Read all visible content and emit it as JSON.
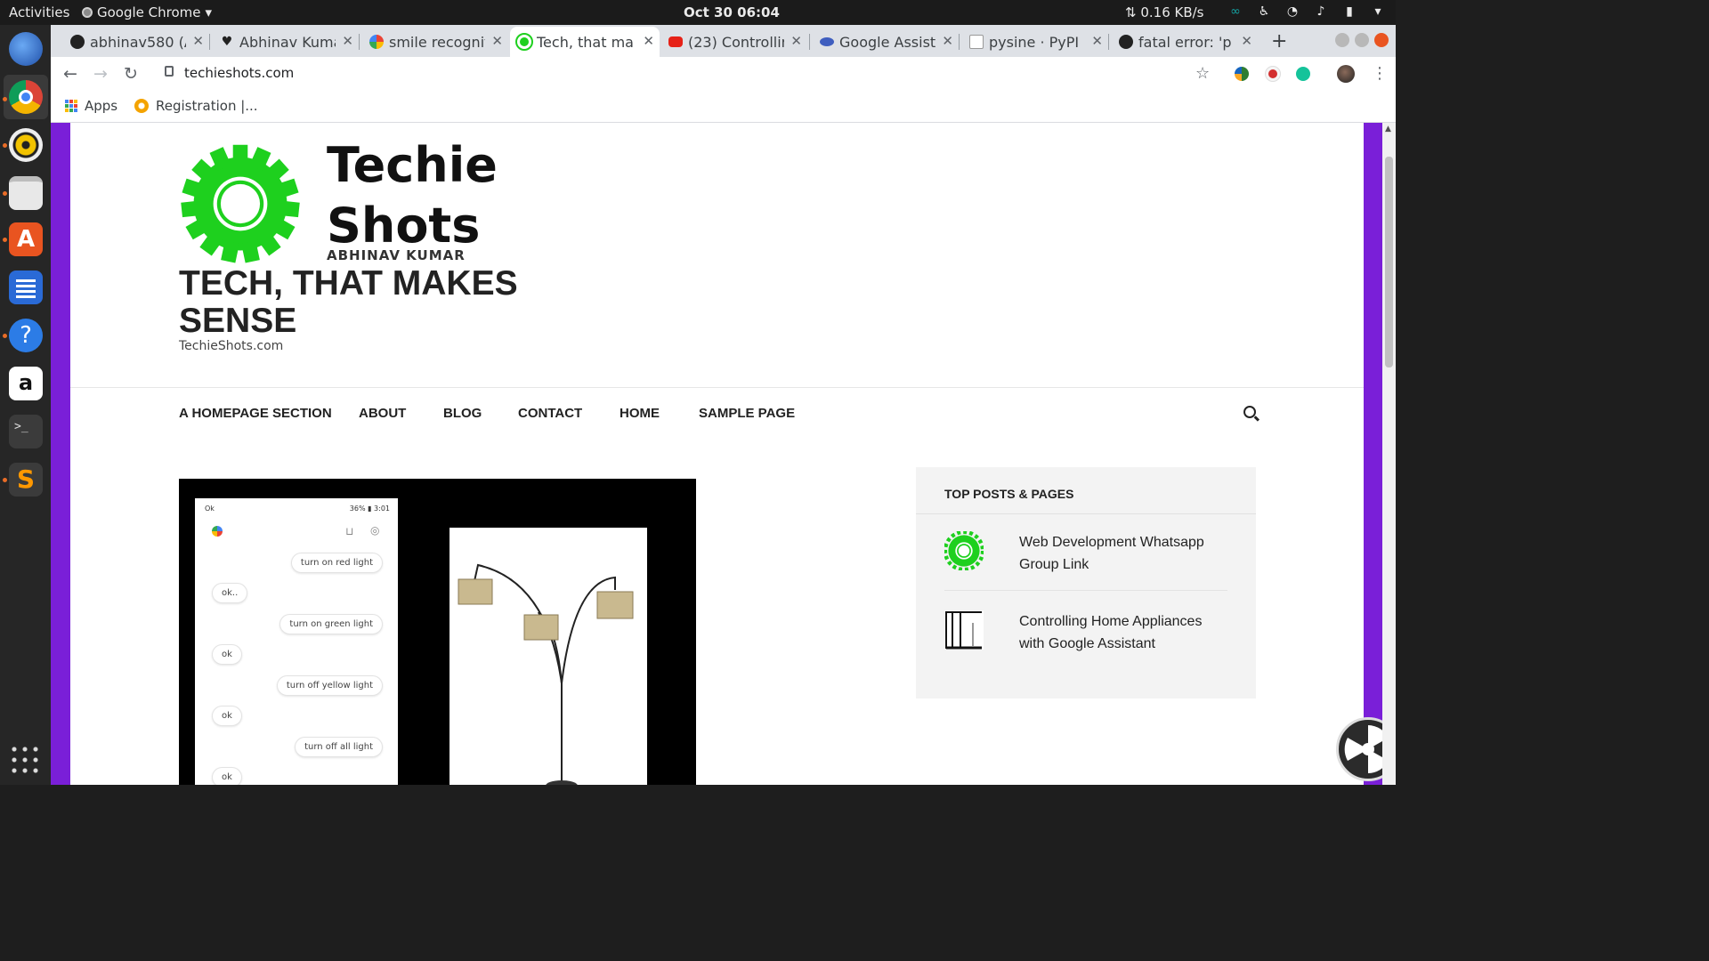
{
  "desktop": {
    "activities": "Activities",
    "app_menu": "Google Chrome",
    "clock": "Oct 30  06:04",
    "net_speed": "⇅ 0.16 KB/s"
  },
  "dock": {
    "items": [
      "thunderbird",
      "chrome",
      "rhythmbox",
      "files",
      "software",
      "writer",
      "help",
      "amazon",
      "terminal",
      "sublime",
      "show-apps"
    ]
  },
  "browser": {
    "tabs": [
      {
        "title": "abhinav580 (A",
        "icon": "github-icon"
      },
      {
        "title": "Abhinav Kuma",
        "icon": "heart-icon"
      },
      {
        "title": "smile recognit",
        "icon": "google-icon"
      },
      {
        "title": "Tech, that ma",
        "icon": "gear-icon",
        "active": true
      },
      {
        "title": "(23) Controllin",
        "icon": "youtube-icon"
      },
      {
        "title": "Google Assist",
        "icon": "assistant-icon"
      },
      {
        "title": "pysine · PyPI",
        "icon": "pypi-icon"
      },
      {
        "title": "fatal error: 'p",
        "icon": "github-icon"
      }
    ],
    "url": "techieshots.com",
    "bookmarks": {
      "apps": "Apps",
      "registration": "Registration |..."
    }
  },
  "site": {
    "logo_line1": "Techie",
    "logo_line2": "Shots",
    "logo_sub": "ABHINAV KUMAR",
    "title": "TECH, THAT MAKES SENSE",
    "tagline": "TechieShots.com",
    "menu": [
      "A HOMEPAGE SECTION",
      "ABOUT",
      "BLOG",
      "CONTACT",
      "HOME",
      "SAMPLE PAGE"
    ],
    "featured": {
      "status_left": "Ok",
      "status_right": "36% ▮ 3:01",
      "chat": [
        "turn on red light",
        "ok..",
        "turn on green light",
        "ok",
        "turn off yellow light",
        "ok",
        "turn off all light",
        "ok"
      ]
    },
    "sidebar": {
      "heading": "TOP POSTS & PAGES",
      "posts": [
        "Web Development Whatsapp Group Link",
        "Controlling Home Appliances with Google Assistant"
      ]
    }
  },
  "colors": {
    "accent_purple": "#7a1fd8",
    "logo_green": "#1ed01e"
  }
}
